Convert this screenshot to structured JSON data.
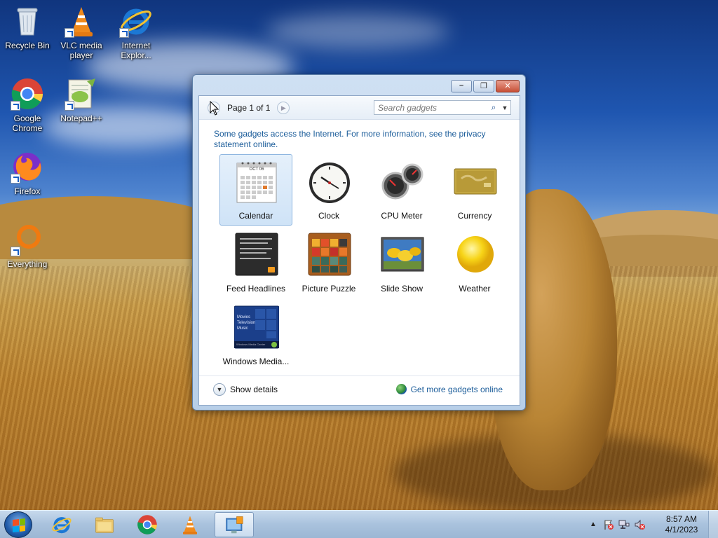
{
  "desktop": {
    "icons": [
      {
        "label": "Recycle Bin"
      },
      {
        "label": "VLC media player"
      },
      {
        "label": "Internet Explor..."
      },
      {
        "label": "Google Chrome"
      },
      {
        "label": "Notepad++"
      },
      {
        "label": "Firefox"
      },
      {
        "label": "Everything"
      }
    ]
  },
  "gadget_window": {
    "page_label": "Page 1 of 1",
    "search_placeholder": "Search gadgets",
    "notice": "Some gadgets access the Internet.  For more information, see the privacy statement online.",
    "gadgets": [
      {
        "name": "Calendar",
        "selected": true
      },
      {
        "name": "Clock"
      },
      {
        "name": "CPU Meter"
      },
      {
        "name": "Currency"
      },
      {
        "name": "Feed Headlines"
      },
      {
        "name": "Picture Puzzle"
      },
      {
        "name": "Slide Show"
      },
      {
        "name": "Weather"
      },
      {
        "name": "Windows Media..."
      }
    ],
    "calendar_month": "OCT 06",
    "media_center_lines": [
      "Movies",
      "Television",
      "Music"
    ],
    "media_center_bar": "Windows Media Center",
    "show_details": "Show details",
    "get_more": "Get more gadgets online"
  },
  "taskbar": {
    "time": "8:57 AM",
    "date": "4/1/2023"
  }
}
